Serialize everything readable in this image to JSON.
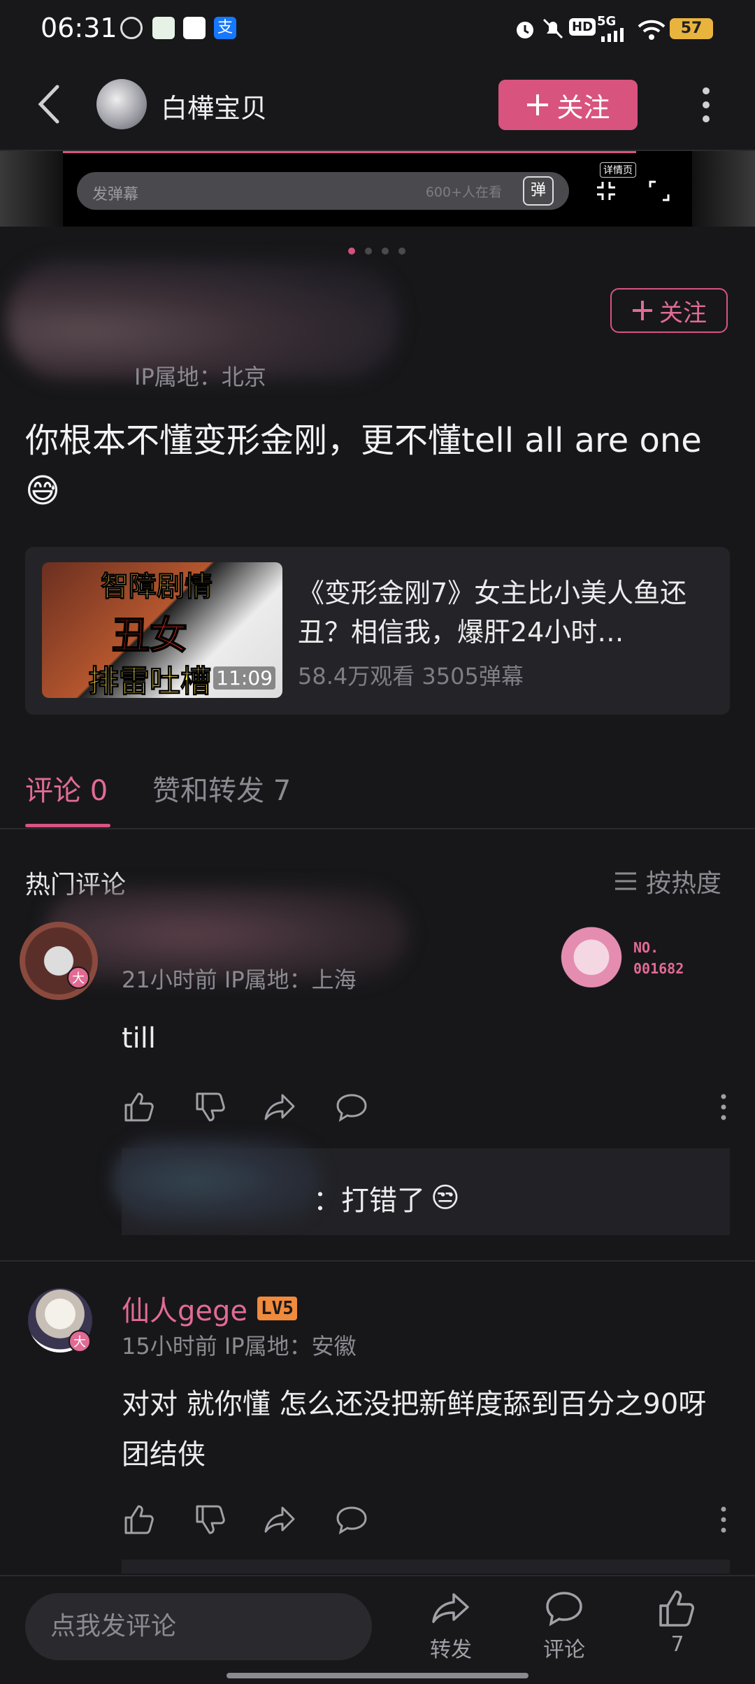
{
  "status_bar": {
    "time": "06:31",
    "network": "5G",
    "hd": "HD",
    "battery": "57"
  },
  "header": {
    "username": "白樺宝贝",
    "follow_label": "关注"
  },
  "video": {
    "danmaku_placeholder": "发弹幕",
    "online": "600+人在看",
    "danmaku_button": "弹",
    "detail_label": "详情页"
  },
  "post": {
    "follow_label": "关注",
    "ip_location": "IP属地：北京",
    "text": "你根本不懂变形金刚，更不懂tell all are one 😅",
    "link": {
      "thumb_line1": "智障剧情",
      "thumb_line2": "丑女",
      "thumb_line3": "排雷吐槽",
      "duration": "11:09",
      "title": "《变形金刚7》女主比小美人鱼还丑？相信我，爆肝24小时…",
      "stats": "58.4万观看 3505弹幕"
    }
  },
  "tabs": {
    "comments": "评论 0",
    "likes_reposts": "赞和转发 7"
  },
  "comments_section": {
    "hot_label": "热门评论",
    "sort_label": "按热度"
  },
  "comments": [
    {
      "vip_badge": "大",
      "meta": "21小时前 IP属地：上海",
      "badge_line1": "NO.",
      "badge_line2": "001682",
      "text": "till",
      "reply_text": "：打错了",
      "reply_emoji": "😒"
    },
    {
      "name": "仙人gege",
      "level": "LV5",
      "vip_badge": "大",
      "meta": "15小时前 IP属地：安徽",
      "text": "对对 就你懂 怎么还没把新鲜度舔到百分之90呀 团结侠"
    }
  ],
  "bottom_bar": {
    "input_placeholder": "点我发评论",
    "repost_label": "转发",
    "comment_label": "评论",
    "like_count": "7"
  },
  "colors": {
    "accent": "#d8547f",
    "background": "#17171a",
    "muted_text": "#8a8a90"
  }
}
